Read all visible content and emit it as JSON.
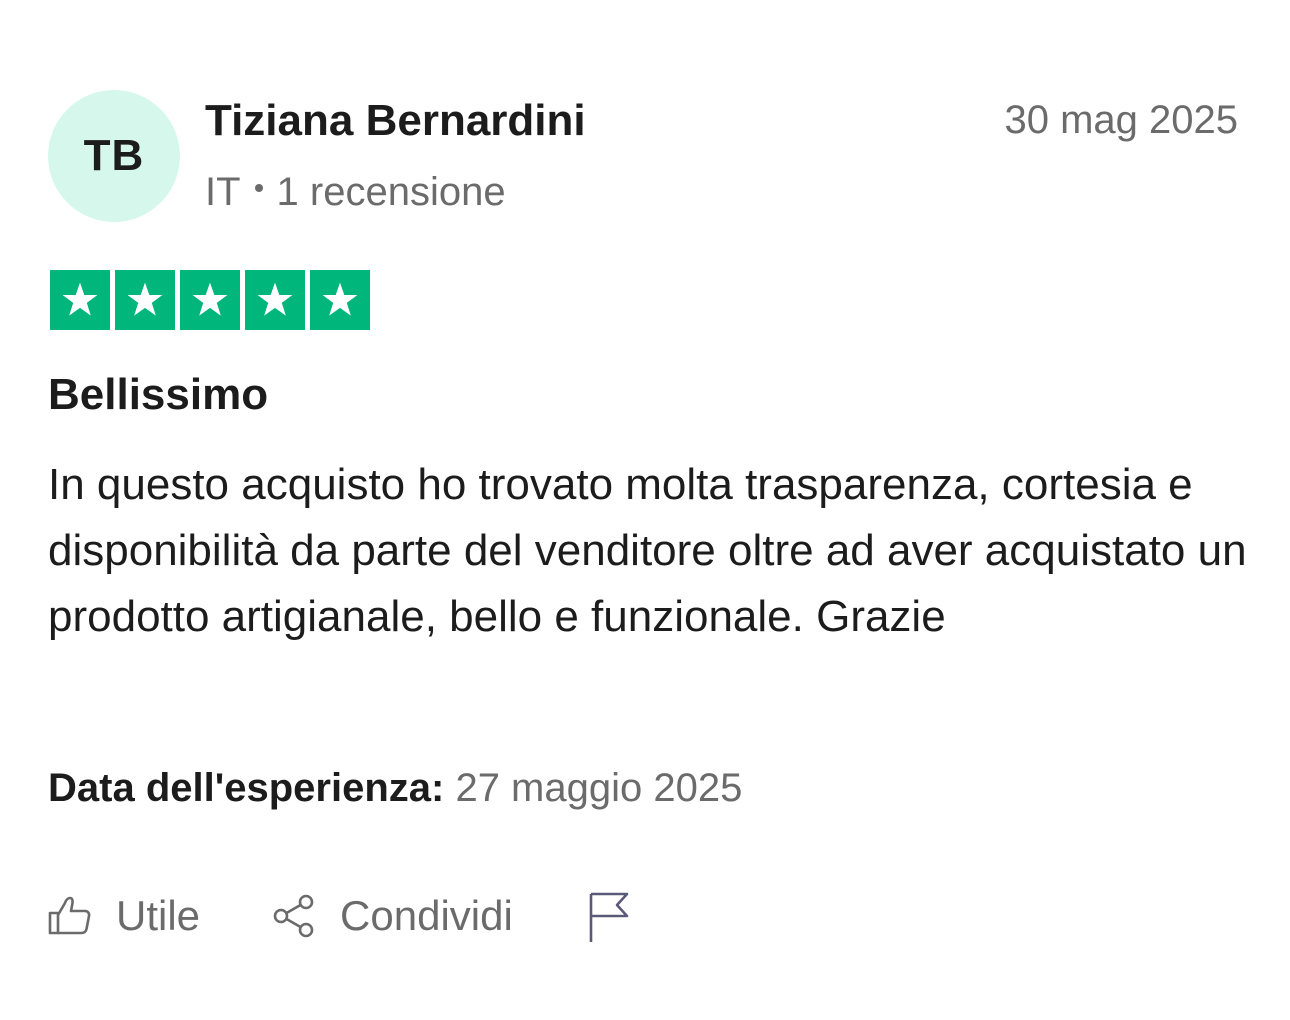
{
  "review": {
    "author": {
      "initials": "TB",
      "name": "Tiziana Bernardini",
      "country": "IT",
      "review_count": "1 recensione"
    },
    "date": "30 mag 2025",
    "rating": 5,
    "rating_max": 5,
    "title": "Bellissimo",
    "text": "In questo acquisto ho trovato molta trasparenza, cortesia e disponibilità da parte del venditore oltre ad aver acquistato un prodotto artigianale, bello e funzionale. Grazie",
    "experience": {
      "label": "Data dell'esperienza:",
      "value": "27 maggio 2025"
    }
  },
  "actions": {
    "useful_label": "Utile",
    "share_label": "Condividi"
  },
  "icons": {
    "useful": "thumbs-up-icon",
    "share": "share-icon",
    "report": "flag-icon",
    "star": "star-icon"
  },
  "colors": {
    "star_bg": "#00b67a",
    "avatar_bg": "#d6f7ec",
    "muted_text": "#6b6b6b",
    "primary_text": "#1c1c1c"
  }
}
